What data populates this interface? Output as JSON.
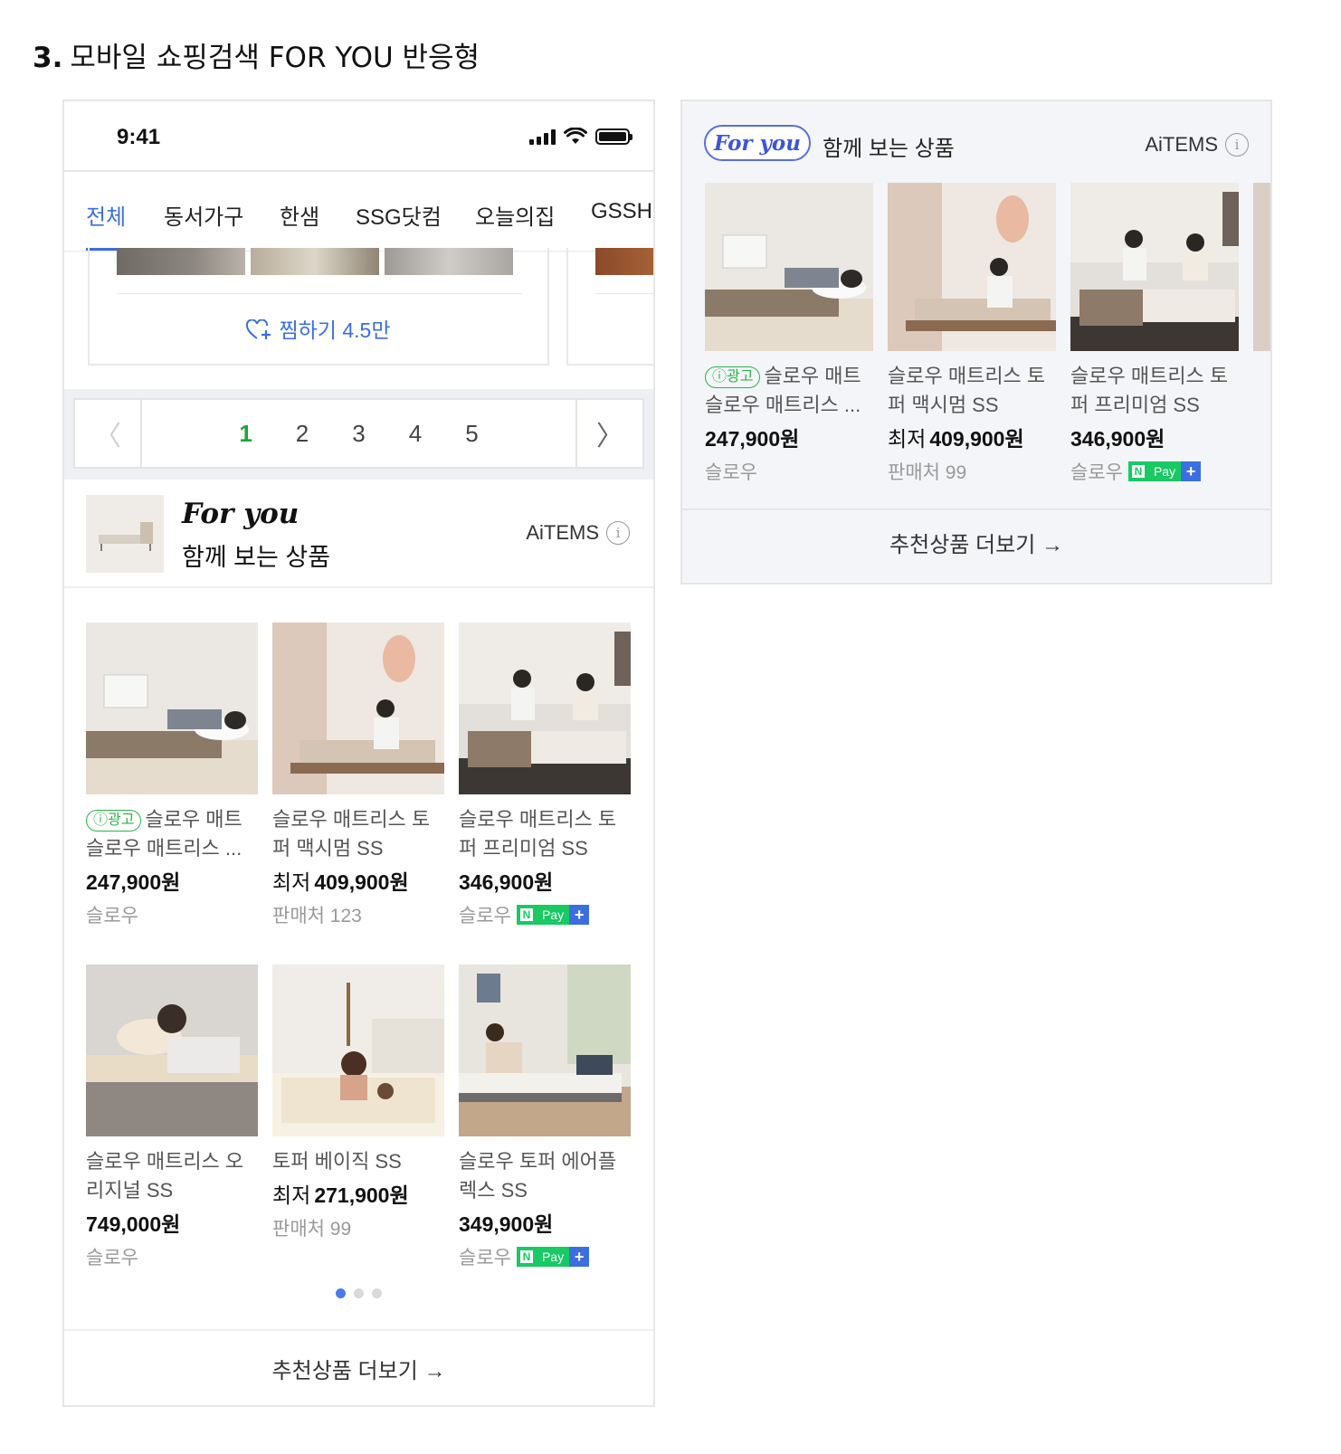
{
  "doc": {
    "title_num": "3.",
    "title": "모바일 쇼핑검색 FOR YOU 반응형"
  },
  "mobile": {
    "time": "9:41",
    "tabs": [
      "전체",
      "동서가구",
      "한샘",
      "SSG닷컴",
      "오늘의집",
      "GSSH"
    ],
    "wish_label": "찜하기 4.5만",
    "pages": [
      "1",
      "2",
      "3",
      "4",
      "5"
    ],
    "foryou_logo": "For you",
    "foryou_sub": "함께 보는 상품",
    "aitems": "AiTEMS",
    "products": [
      {
        "ad": "ⓘ광고",
        "name1": "슬로우 매트",
        "name2": "슬로우 매트리스 ...",
        "price_pre": "",
        "price": "247,900원",
        "seller": "슬로우",
        "npay": false
      },
      {
        "ad": "",
        "name1": "슬로우 매트리스 토",
        "name2": "퍼 맥시멈 SS",
        "price_pre": "최저",
        "price": "409,900원",
        "seller": "판매처 123",
        "npay": false
      },
      {
        "ad": "",
        "name1": "슬로우 매트리스 토",
        "name2": "퍼 프리미엄 SS",
        "price_pre": "",
        "price": "346,900원",
        "seller": "슬로우",
        "npay": true
      },
      {
        "ad": "",
        "name1": "슬로우 매트리스 오",
        "name2": "리지널 SS",
        "price_pre": "",
        "price": "749,000원",
        "seller": "슬로우",
        "npay": false
      },
      {
        "ad": "",
        "name1": "토퍼 베이직 SS",
        "name2": "",
        "price_pre": "최저",
        "price": "271,900원",
        "seller": "판매처 99",
        "npay": false
      },
      {
        "ad": "",
        "name1": "슬로우 토퍼 에어플",
        "name2": "렉스 SS",
        "price_pre": "",
        "price": "349,900원",
        "seller": "슬로우",
        "npay": true
      }
    ],
    "more": "추천상품 더보기 →"
  },
  "panel": {
    "pill": "For you",
    "sub": "함께 보는 상품",
    "aitems": "AiTEMS",
    "products": [
      {
        "ad": "ⓘ광고",
        "name1": "슬로우 매트",
        "name2": "슬로우 매트리스 ...",
        "price_pre": "",
        "price": "247,900원",
        "seller": "슬로우",
        "npay": false
      },
      {
        "ad": "",
        "name1": "슬로우 매트리스 토",
        "name2": "퍼 맥시멈 SS",
        "price_pre": "최저",
        "price": "409,900원",
        "seller": "판매처 99",
        "npay": false
      },
      {
        "ad": "",
        "name1": "슬로우 매트리스 토",
        "name2": "퍼 프리미엄 SS",
        "price_pre": "",
        "price": "346,900원",
        "seller": "슬로우",
        "npay": true
      }
    ],
    "more": "추천상품 더보기 →"
  },
  "npay": {
    "n": "N",
    "pay": "Pay",
    "plus": "+"
  }
}
